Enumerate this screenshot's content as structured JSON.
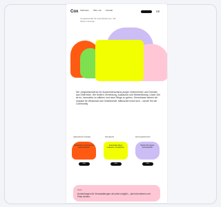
{
  "header": {
    "logo": "Cox",
    "nav": [
      "Startseite",
      "Über uns",
      "Kontakt"
    ],
    "language": "DE"
  },
  "hero": {
    "subtitle": "Jungwirtschaft für Zukunftsthemen. Wir fördern Gründer."
  },
  "intro": {
    "text": "Die Jungwirtschaft ist ein Zusammenschluss junger Unternehmer und Gründer aus Österreich. Wir fördern Vernetzung, Austausch und Weiterbildung. Unser Ziel ist es, Innovation zu stärken und neue Wege zu gehen. Gemeinsam setzen wir Impulse für Wirtschaft und Gesellschaft. Mitmachen lohnt sich – werde Teil der Community."
  },
  "cards": [
    {
      "title": "Veranstaltungen",
      "text": "Netzwerken und lernen bei unseren Events.",
      "button": "Mehr",
      "color": "#ff5a12"
    },
    {
      "title": "Projekte",
      "text": "Gemeinsam Ideen umsetzen und wachsen.",
      "button": "Mehr",
      "color": "#f2ff00"
    },
    {
      "title": "Mitgliedschaft",
      "text": "Werde Teil unserer Gemeinschaft.",
      "button": "Mehr",
      "color": "#cdbdf5"
    }
  ],
  "banner": {
    "tag": "News",
    "text": "Anmeldungen für Veranstaltungen ab sofort möglich – jetzt informieren und Platz sichern."
  },
  "colors": {
    "orange": "#ff5a12",
    "yellow": "#f2ff00",
    "lavender": "#cdbdf5",
    "pink": "#ffc7d6",
    "green": "#7ee04f"
  }
}
